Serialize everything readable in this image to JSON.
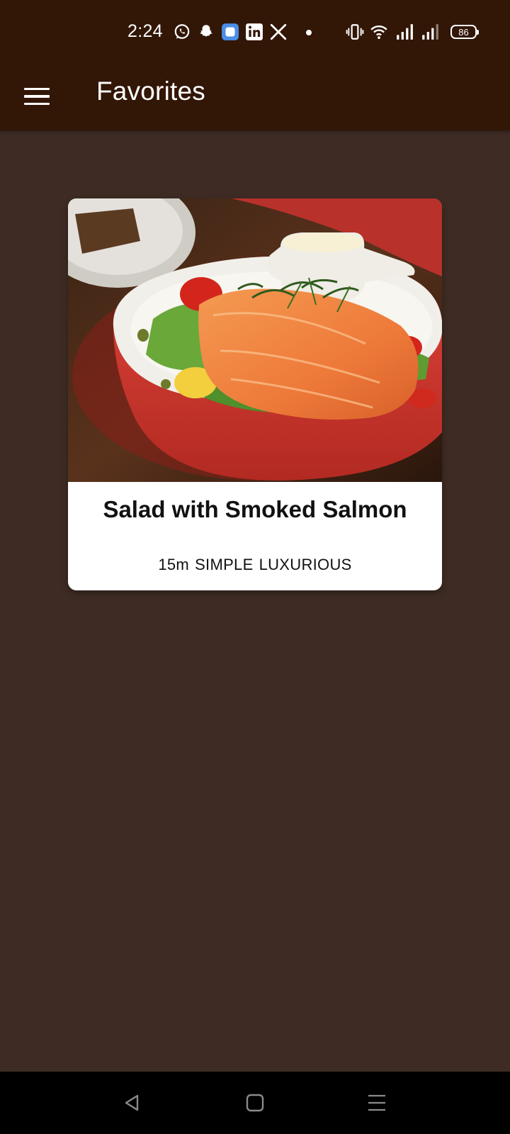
{
  "status_bar": {
    "time": "2:24",
    "battery": "86",
    "notification_icons": [
      "whatsapp-icon",
      "snapchat-icon",
      "app-notification-icon",
      "linkedin-icon",
      "x-icon"
    ],
    "system_icons": [
      "vibrate-icon",
      "wifi-icon",
      "signal-icon",
      "signal-icon-2",
      "battery-icon"
    ]
  },
  "app_bar": {
    "title": "Favorites",
    "menu_icon": "hamburger-menu-icon"
  },
  "favorites": [
    {
      "title": "Salad with Smoked Salmon",
      "duration": "15m",
      "complexity": "SIMPLE",
      "affordability": "LUXURIOUS",
      "image": "smoked-salmon-salad-photo"
    }
  ],
  "nav_bar": {
    "buttons": [
      "back-icon",
      "home-icon",
      "recents-icon"
    ]
  },
  "colors": {
    "app_bar": "#321606",
    "background": "#3e2c24",
    "card": "#ffffff",
    "nav_bar": "#000000"
  }
}
